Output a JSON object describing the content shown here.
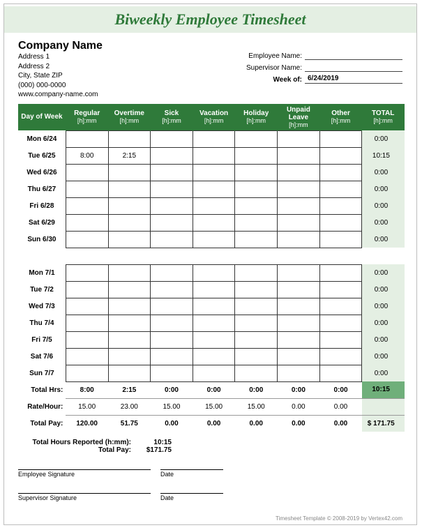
{
  "title": "Biweekly Employee Timesheet",
  "company": {
    "name": "Company Name",
    "addr1": "Address 1",
    "addr2": "Address 2",
    "citystzip": "City, State  ZIP",
    "phone": "(000) 000-0000",
    "web": "www.company-name.com"
  },
  "fields": {
    "employee_label": "Employee Name:",
    "employee_value": "",
    "supervisor_label": "Supervisor Name:",
    "supervisor_value": "",
    "weekof_label": "Week of:",
    "weekof_value": "6/24/2019"
  },
  "columns": {
    "day": "Day of Week",
    "regular": "Regular",
    "regular_sub": "[h]:mm",
    "overtime": "Overtime",
    "overtime_sub": "[h]:mm",
    "sick": "Sick",
    "sick_sub": "[h]:mm",
    "vacation": "Vacation",
    "vacation_sub": "[h]:mm",
    "holiday": "Holiday",
    "holiday_sub": "[h]:mm",
    "unpaid": "Unpaid Leave",
    "unpaid_sub": "[h]:mm",
    "other": "Other",
    "other_sub": "[h]:mm",
    "total": "TOTAL",
    "total_sub": "[h]:mm"
  },
  "week1": [
    {
      "day": "Mon 6/24",
      "reg": "",
      "ot": "",
      "sick": "",
      "vac": "",
      "hol": "",
      "unp": "",
      "oth": "",
      "tot": "0:00"
    },
    {
      "day": "Tue 6/25",
      "reg": "8:00",
      "ot": "2:15",
      "sick": "",
      "vac": "",
      "hol": "",
      "unp": "",
      "oth": "",
      "tot": "10:15"
    },
    {
      "day": "Wed 6/26",
      "reg": "",
      "ot": "",
      "sick": "",
      "vac": "",
      "hol": "",
      "unp": "",
      "oth": "",
      "tot": "0:00"
    },
    {
      "day": "Thu 6/27",
      "reg": "",
      "ot": "",
      "sick": "",
      "vac": "",
      "hol": "",
      "unp": "",
      "oth": "",
      "tot": "0:00"
    },
    {
      "day": "Fri 6/28",
      "reg": "",
      "ot": "",
      "sick": "",
      "vac": "",
      "hol": "",
      "unp": "",
      "oth": "",
      "tot": "0:00"
    },
    {
      "day": "Sat 6/29",
      "reg": "",
      "ot": "",
      "sick": "",
      "vac": "",
      "hol": "",
      "unp": "",
      "oth": "",
      "tot": "0:00"
    },
    {
      "day": "Sun 6/30",
      "reg": "",
      "ot": "",
      "sick": "",
      "vac": "",
      "hol": "",
      "unp": "",
      "oth": "",
      "tot": "0:00"
    }
  ],
  "week2": [
    {
      "day": "Mon 7/1",
      "reg": "",
      "ot": "",
      "sick": "",
      "vac": "",
      "hol": "",
      "unp": "",
      "oth": "",
      "tot": "0:00"
    },
    {
      "day": "Tue 7/2",
      "reg": "",
      "ot": "",
      "sick": "",
      "vac": "",
      "hol": "",
      "unp": "",
      "oth": "",
      "tot": "0:00"
    },
    {
      "day": "Wed 7/3",
      "reg": "",
      "ot": "",
      "sick": "",
      "vac": "",
      "hol": "",
      "unp": "",
      "oth": "",
      "tot": "0:00"
    },
    {
      "day": "Thu 7/4",
      "reg": "",
      "ot": "",
      "sick": "",
      "vac": "",
      "hol": "",
      "unp": "",
      "oth": "",
      "tot": "0:00"
    },
    {
      "day": "Fri 7/5",
      "reg": "",
      "ot": "",
      "sick": "",
      "vac": "",
      "hol": "",
      "unp": "",
      "oth": "",
      "tot": "0:00"
    },
    {
      "day": "Sat 7/6",
      "reg": "",
      "ot": "",
      "sick": "",
      "vac": "",
      "hol": "",
      "unp": "",
      "oth": "",
      "tot": "0:00"
    },
    {
      "day": "Sun 7/7",
      "reg": "",
      "ot": "",
      "sick": "",
      "vac": "",
      "hol": "",
      "unp": "",
      "oth": "",
      "tot": "0:00"
    }
  ],
  "totals": {
    "label": "Total Hrs:",
    "reg": "8:00",
    "ot": "2:15",
    "sick": "0:00",
    "vac": "0:00",
    "hol": "0:00",
    "unp": "0:00",
    "oth": "0:00",
    "tot": "10:15"
  },
  "rate": {
    "label": "Rate/Hour:",
    "reg": "15.00",
    "ot": "23.00",
    "sick": "15.00",
    "vac": "15.00",
    "hol": "15.00",
    "unp": "0.00",
    "oth": "0.00"
  },
  "pay": {
    "label": "Total Pay:",
    "reg": "120.00",
    "ot": "51.75",
    "sick": "0.00",
    "vac": "0.00",
    "hol": "0.00",
    "unp": "0.00",
    "oth": "0.00",
    "tot": "$   171.75"
  },
  "summary": {
    "hours_label": "Total Hours Reported (h:mm):",
    "hours_value": "10:15",
    "pay_label": "Total Pay:",
    "pay_value": "$171.75"
  },
  "signatures": {
    "employee": "Employee Signature",
    "supervisor": "Supervisor Signature",
    "date": "Date"
  },
  "footer": "Timesheet Template © 2008-2019 by Vertex42.com"
}
